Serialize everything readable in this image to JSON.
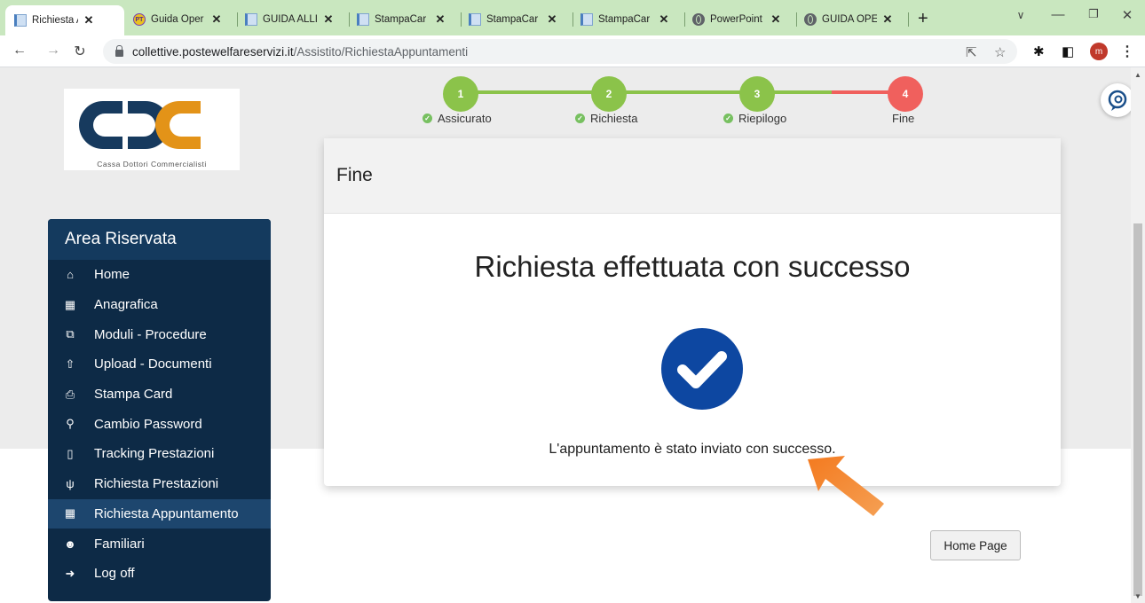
{
  "browser": {
    "tabs": [
      {
        "title": "Richiesta Ap",
        "favicon": "doc-icon",
        "active": true
      },
      {
        "title": "Guida Oper",
        "favicon": "pt-icon",
        "active": false
      },
      {
        "title": "GUIDA ALLI",
        "favicon": "doc-icon",
        "active": false
      },
      {
        "title": "StampaCar",
        "favicon": "doc-icon",
        "active": false
      },
      {
        "title": "StampaCar",
        "favicon": "doc-icon",
        "active": false
      },
      {
        "title": "StampaCar",
        "favicon": "doc-icon",
        "active": false
      },
      {
        "title": "PowerPoint",
        "favicon": "globe-icon",
        "active": false
      },
      {
        "title": "GUIDA OPE",
        "favicon": "globe-icon",
        "active": false
      }
    ],
    "pt_favicon_text": "PT",
    "url_host": "collettive.postewelfareservizi.it",
    "url_path": "/Assistito/RichiestaAppuntamenti",
    "profile_initial": "m"
  },
  "logo": {
    "tagline": "Cassa Dottori Commercialisti"
  },
  "sidebar": {
    "title": "Area Riservata",
    "items": [
      {
        "label": "Home",
        "icon": "home-icon",
        "active": false
      },
      {
        "label": "Anagrafica",
        "icon": "bank-icon",
        "active": false
      },
      {
        "label": "Moduli - Procedure",
        "icon": "copy-icon",
        "active": false
      },
      {
        "label": "Upload - Documenti",
        "icon": "upload-icon",
        "active": false
      },
      {
        "label": "Stampa Card",
        "icon": "print-icon",
        "active": false
      },
      {
        "label": "Cambio Password",
        "icon": "key-icon",
        "active": false
      },
      {
        "label": "Tracking Prestazioni",
        "icon": "book-icon",
        "active": false
      },
      {
        "label": "Richiesta Prestazioni",
        "icon": "stethoscope-icon",
        "active": false
      },
      {
        "label": "Richiesta Appuntamento",
        "icon": "calendar-icon",
        "active": true
      },
      {
        "label": "Familiari",
        "icon": "users-icon",
        "active": false
      },
      {
        "label": "Log off",
        "icon": "logout-icon",
        "active": false
      }
    ]
  },
  "stepper": {
    "steps": [
      {
        "number": "1",
        "label": "Assicurato",
        "completed": true
      },
      {
        "number": "2",
        "label": "Richiesta",
        "completed": true
      },
      {
        "number": "3",
        "label": "Riepilogo",
        "completed": true
      },
      {
        "number": "4",
        "label": "Fine",
        "completed": false
      }
    ],
    "completed_color": "#8bc34a",
    "current_color": "#f0605d"
  },
  "panel": {
    "header": "Fine",
    "title": "Richiesta effettuata con successo",
    "message": "L'appuntamento è stato inviato con successo."
  },
  "home_button": "Home Page",
  "colors": {
    "sidebar": "#0d2a46",
    "success": "#0d47a1",
    "arrow": "#f07f2a",
    "tabbar": "#c9e7bf"
  }
}
